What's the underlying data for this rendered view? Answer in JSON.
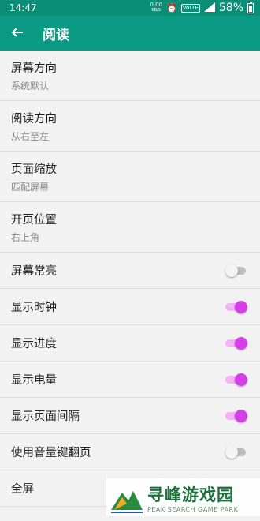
{
  "status_bar": {
    "time": "14:47",
    "net_speed_value": "0.00",
    "net_speed_unit": "KB/S",
    "volte": "VoLTE",
    "battery_percent": "58%"
  },
  "app_bar": {
    "title": "阅读"
  },
  "settings": {
    "screen_orientation": {
      "label": "屏幕方向",
      "value": "系统默认"
    },
    "reading_direction": {
      "label": "阅读方向",
      "value": "从右至左"
    },
    "page_scaling": {
      "label": "页面缩放",
      "value": "匹配屏幕"
    },
    "start_position": {
      "label": "开页位置",
      "value": "右上角"
    },
    "keep_screen_on": {
      "label": "屏幕常亮",
      "enabled": false
    },
    "show_clock": {
      "label": "显示时钟",
      "enabled": true
    },
    "show_progress": {
      "label": "显示进度",
      "enabled": true
    },
    "show_battery": {
      "label": "显示电量",
      "enabled": true
    },
    "show_page_gap": {
      "label": "显示页面间隔",
      "enabled": true
    },
    "volume_key_paging": {
      "label": "使用音量键翻页",
      "enabled": false
    },
    "fullscreen": {
      "label": "全屏"
    }
  },
  "colors": {
    "status_bar": "#0b8d78",
    "app_bar": "#0b9a83",
    "switch_on": "#d63ee8",
    "switch_on_track": "#f4b2f4"
  },
  "watermark": {
    "cn": "寻峰游戏园",
    "en": "PEAK SEARCH GAME PARK"
  }
}
